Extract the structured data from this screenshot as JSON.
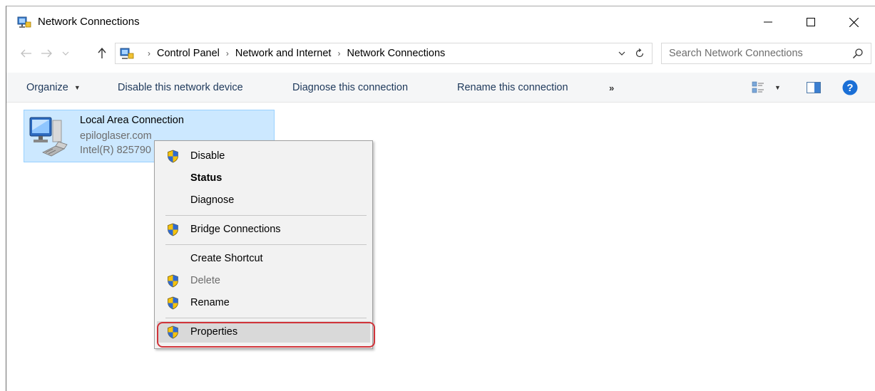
{
  "window": {
    "title": "Network Connections",
    "controls": {
      "minimize": "—",
      "maximize": "☐",
      "close": "✕"
    }
  },
  "address": {
    "breadcrumbs": [
      "Control Panel",
      "Network and Internet",
      "Network Connections"
    ],
    "search_placeholder": "Search Network Connections"
  },
  "commandbar": {
    "organize": "Organize",
    "disable": "Disable this network device",
    "diagnose": "Diagnose this connection",
    "rename": "Rename this connection",
    "more": "»"
  },
  "connection": {
    "name": "Local Area Connection",
    "domain": "epiloglaser.com",
    "adapter": "Intel(R) 825790"
  },
  "context_menu": {
    "items": [
      {
        "label": "Disable",
        "shield": true,
        "bold": false,
        "disabled": false
      },
      {
        "label": "Status",
        "shield": false,
        "bold": true,
        "disabled": false
      },
      {
        "label": "Diagnose",
        "shield": false,
        "bold": false,
        "disabled": false
      },
      {
        "label": "Bridge Connections",
        "shield": true,
        "bold": false,
        "disabled": false
      },
      {
        "label": "Create Shortcut",
        "shield": false,
        "bold": false,
        "disabled": false
      },
      {
        "label": "Delete",
        "shield": true,
        "bold": false,
        "disabled": true
      },
      {
        "label": "Rename",
        "shield": true,
        "bold": false,
        "disabled": false
      },
      {
        "label": "Properties",
        "shield": true,
        "bold": false,
        "disabled": false
      }
    ],
    "highlighted": "Properties"
  },
  "colors": {
    "selection_fill": "#cce8ff",
    "selection_border": "#99d1ff",
    "highlight_ring": "#d0343a",
    "help_blue": "#1a6fd6"
  }
}
